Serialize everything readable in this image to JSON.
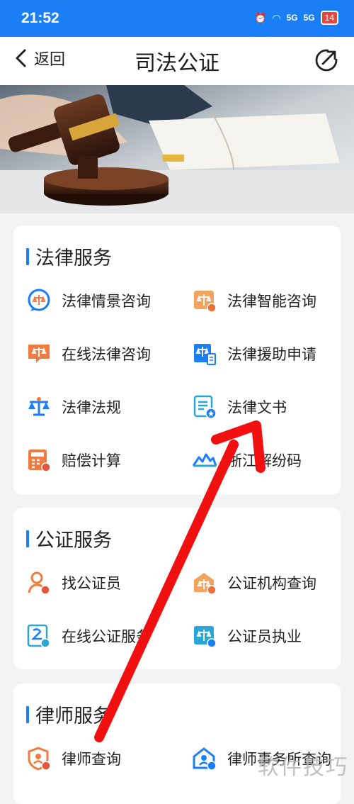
{
  "status": {
    "time": "21:52",
    "network": "5G",
    "battery": "14"
  },
  "nav": {
    "back_label": "返回",
    "title": "司法公证"
  },
  "legal": {
    "title": "法律服务",
    "items": [
      "法律情景咨询",
      "法律智能咨询",
      "在线法律咨询",
      "法律援助申请",
      "法律法规",
      "法律文书",
      "赔偿计算",
      "浙江解纷码"
    ]
  },
  "notary": {
    "title": "公证服务",
    "items": [
      "找公证员",
      "公证机构查询",
      "在线公证服务",
      "公证员执业"
    ]
  },
  "lawyer": {
    "title": "律师服务",
    "items": [
      "律师查询",
      "律师事务所查询"
    ]
  },
  "watermark": "软件技巧",
  "colors": {
    "accent": "#1a7ef7",
    "orange": "#f07b3f",
    "arrow": "#f01010"
  }
}
